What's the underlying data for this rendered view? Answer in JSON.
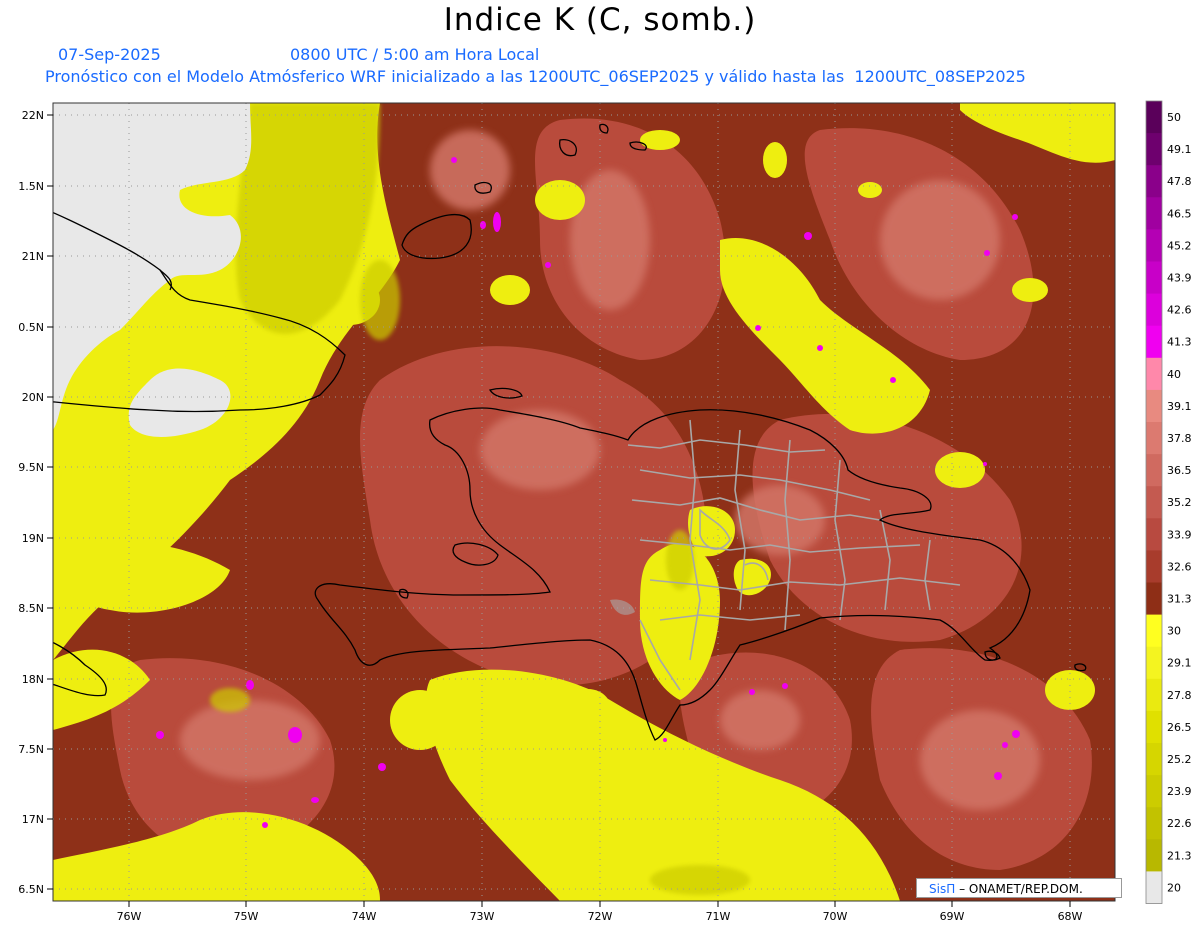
{
  "header": {
    "title": "Indice K (C, somb.)",
    "date": "07-Sep-2025",
    "time": "0800 UTC / 5:00 am Hora Local",
    "description": "Pronóstico con el Modelo Atmósferico WRF inicializado a las 1200UTC_06SEP2025 y válido hasta las  1200UTC_08SEP2025"
  },
  "map": {
    "lat_labels": [
      "22N",
      "1.5N",
      "21N",
      "0.5N",
      "20N",
      "9.5N",
      "19N",
      "8.5N",
      "18N",
      "7.5N",
      "17N",
      "6.5N"
    ],
    "lon_labels": [
      "76W",
      "75W",
      "74W",
      "73W",
      "72W",
      "71W",
      "70W",
      "69W",
      "68W"
    ],
    "colors": {
      "dry": "#e8e8e8",
      "yellow_low": "#c8c800",
      "yellow": "#e8e800",
      "yellow_bright": "#f4f400",
      "brown_dark": "#7e2a14",
      "brown": "#943a20",
      "brown_mid": "#b84a38",
      "salmon": "#c9625a",
      "pink": "#e0807a",
      "magenta": "#f000f0"
    }
  },
  "colorbar": {
    "labels": [
      "50",
      "49.1",
      "47.8",
      "46.5",
      "45.2",
      "43.9",
      "42.6",
      "41.3",
      "40",
      "39.1",
      "37.8",
      "36.5",
      "35.2",
      "33.9",
      "32.6",
      "31.3",
      "30",
      "29.1",
      "27.8",
      "26.5",
      "25.2",
      "23.9",
      "22.6",
      "21.3",
      "20"
    ],
    "colors": [
      "#5a005a",
      "#6e006e",
      "#8a008a",
      "#a000a0",
      "#b400b4",
      "#c800c8",
      "#dc00dc",
      "#f000f0",
      "#ff88aa",
      "#e88a80",
      "#dc7a70",
      "#d06a60",
      "#c45a50",
      "#b84a40",
      "#a83c2c",
      "#8e2e16",
      "#ffff20",
      "#f4f420",
      "#eaea10",
      "#e0e000",
      "#d6d600",
      "#cccc00",
      "#c2c200",
      "#b8b800",
      "#e8e8e8"
    ]
  },
  "footer": {
    "brand": "SisΠ",
    "text": "– ONAMET/REP.DOM."
  }
}
